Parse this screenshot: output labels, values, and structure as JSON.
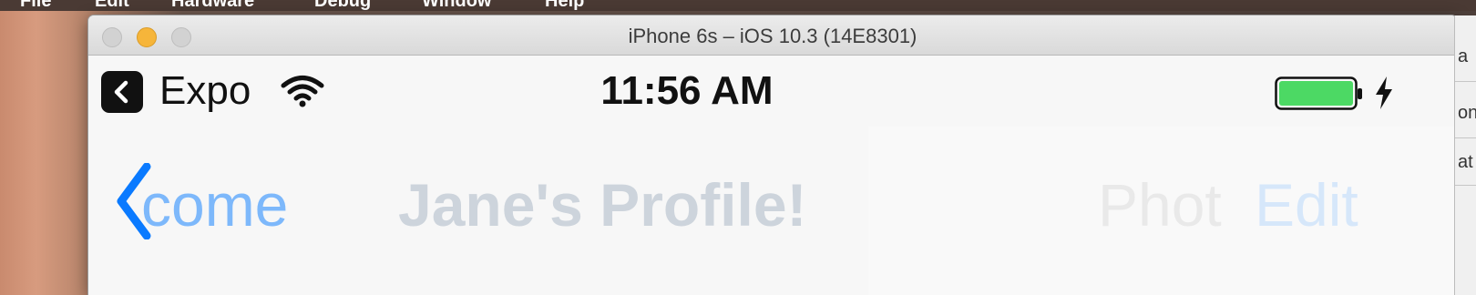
{
  "menubar": {
    "items": [
      "File",
      "Edit",
      "Hardware",
      "Debug",
      "Window",
      "Help"
    ]
  },
  "window": {
    "title": "iPhone 6s – iOS 10.3 (14E8301)"
  },
  "status_bar": {
    "app_name": "Expo",
    "time": "11:56 AM",
    "battery_color": "#4cd964"
  },
  "nav_bar": {
    "back_label": "come",
    "title": "Jane's Profile!",
    "ghost_title": "Phot",
    "right_button": "Edit",
    "accent_color": "#007aff"
  },
  "side_window": {
    "fragments": [
      "a",
      "on",
      "at"
    ]
  }
}
